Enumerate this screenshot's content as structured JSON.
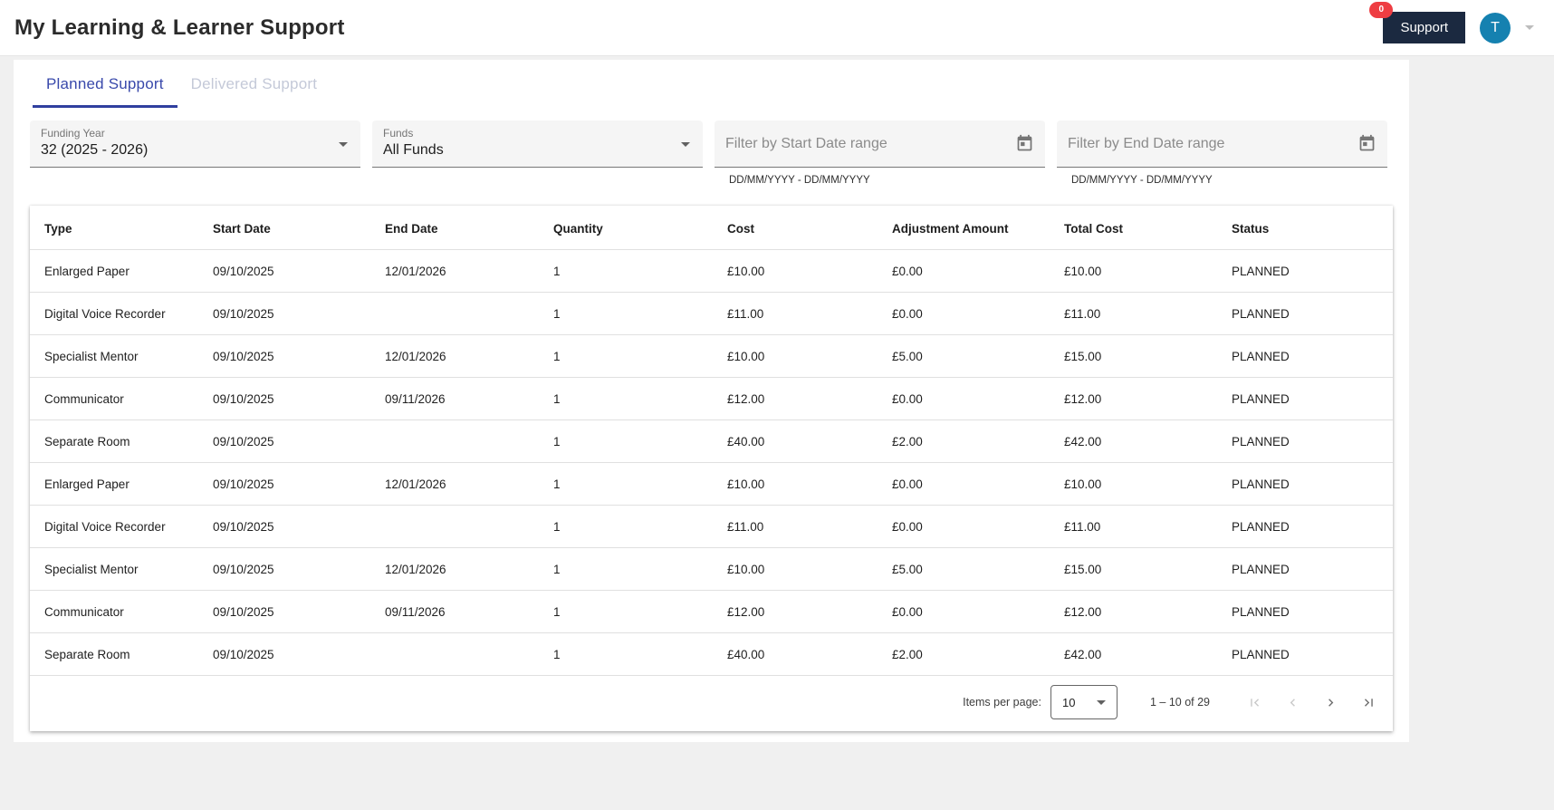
{
  "header": {
    "title": "My Learning & Learner Support",
    "support_button": "Support",
    "support_badge": "0",
    "avatar_initial": "T"
  },
  "tabs": [
    {
      "label": "Planned Support",
      "active": true
    },
    {
      "label": "Delivered Support",
      "active": false
    }
  ],
  "filters": {
    "funding_year": {
      "label": "Funding Year",
      "value": "32 (2025 - 2026)"
    },
    "funds": {
      "label": "Funds",
      "value": "All Funds"
    },
    "start_date": {
      "placeholder": "Filter by Start Date range",
      "hint": "DD/MM/YYYY - DD/MM/YYYY"
    },
    "end_date": {
      "placeholder": "Filter by End Date range",
      "hint": "DD/MM/YYYY - DD/MM/YYYY"
    }
  },
  "table": {
    "columns": [
      "Type",
      "Start Date",
      "End Date",
      "Quantity",
      "Cost",
      "Adjustment Amount",
      "Total Cost",
      "Status"
    ],
    "rows": [
      [
        "Enlarged Paper",
        "09/10/2025",
        "12/01/2026",
        "1",
        "£10.00",
        "£0.00",
        "£10.00",
        "PLANNED"
      ],
      [
        "Digital Voice Recorder",
        "09/10/2025",
        "",
        "1",
        "£11.00",
        "£0.00",
        "£11.00",
        "PLANNED"
      ],
      [
        "Specialist Mentor",
        "09/10/2025",
        "12/01/2026",
        "1",
        "£10.00",
        "£5.00",
        "£15.00",
        "PLANNED"
      ],
      [
        "Communicator",
        "09/10/2025",
        "09/11/2026",
        "1",
        "£12.00",
        "£0.00",
        "£12.00",
        "PLANNED"
      ],
      [
        "Separate Room",
        "09/10/2025",
        "",
        "1",
        "£40.00",
        "£2.00",
        "£42.00",
        "PLANNED"
      ],
      [
        "Enlarged Paper",
        "09/10/2025",
        "12/01/2026",
        "1",
        "£10.00",
        "£0.00",
        "£10.00",
        "PLANNED"
      ],
      [
        "Digital Voice Recorder",
        "09/10/2025",
        "",
        "1",
        "£11.00",
        "£0.00",
        "£11.00",
        "PLANNED"
      ],
      [
        "Specialist Mentor",
        "09/10/2025",
        "12/01/2026",
        "1",
        "£10.00",
        "£5.00",
        "£15.00",
        "PLANNED"
      ],
      [
        "Communicator",
        "09/10/2025",
        "09/11/2026",
        "1",
        "£12.00",
        "£0.00",
        "£12.00",
        "PLANNED"
      ],
      [
        "Separate Room",
        "09/10/2025",
        "",
        "1",
        "£40.00",
        "£2.00",
        "£42.00",
        "PLANNED"
      ]
    ]
  },
  "pagination": {
    "items_per_page_label": "Items per page:",
    "items_per_page_value": "10",
    "range_label": "1 – 10 of 29"
  },
  "colors": {
    "accent": "#3949ab",
    "tab_underline": "#303f9f",
    "support_button_bg": "#1b2940",
    "badge_bg": "#ee3d42",
    "avatar_bg": "#1581b0"
  }
}
